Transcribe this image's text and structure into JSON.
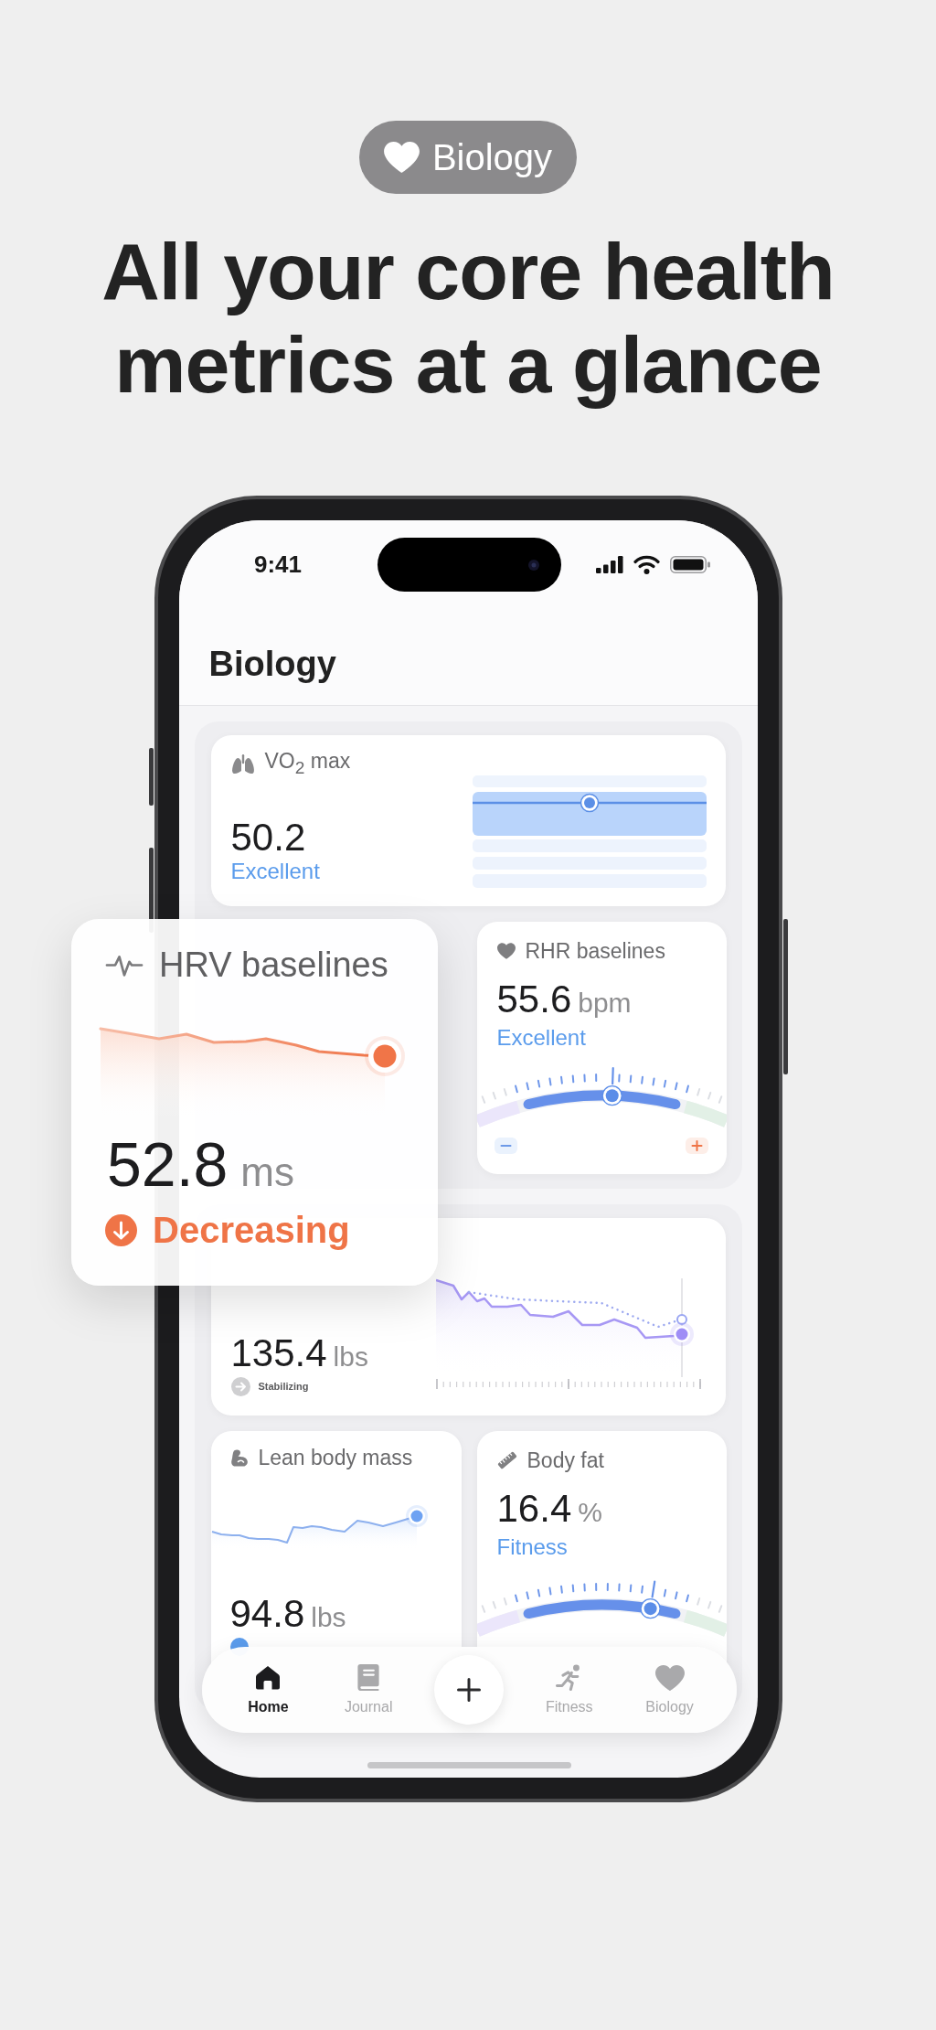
{
  "badge": {
    "label": "Biology"
  },
  "headline": "All your core health metrics at a glance",
  "phone": {
    "status_bar": {
      "time": "9:41"
    },
    "title": "Biology",
    "vo2_card": {
      "title": "VO$_{2}$ max",
      "value": "50.2",
      "status": "Excellent"
    },
    "rhr_card": {
      "title": "RHR baselines",
      "value": "55.6",
      "unit": "bpm",
      "status": "Excellent",
      "level": 0.54
    },
    "weight_card": {
      "value": "135.4",
      "unit": "lbs",
      "trend": {
        "label": "Stabilizing",
        "kind": "steady"
      }
    },
    "lean_body_mass_card": {
      "title": "Lean body mass",
      "value": "94.8",
      "unit": "lbs"
    },
    "body_fat_card": {
      "title": "Body fat",
      "value": "16.4",
      "unit": "%",
      "status": "Fitness",
      "level": 0.69
    },
    "tab_bar": {
      "tabs": [
        {
          "label": "Home",
          "selected": true
        },
        {
          "label": "Journal",
          "selected": false
        },
        {
          "label": "Fitness",
          "selected": false
        },
        {
          "label": "Biology",
          "selected": false
        }
      ]
    }
  },
  "hrv_card": {
    "title": "HRV baselines",
    "value": "52.8",
    "unit": "ms",
    "trend": {
      "label": "Decreasing",
      "kind": "down"
    }
  }
}
